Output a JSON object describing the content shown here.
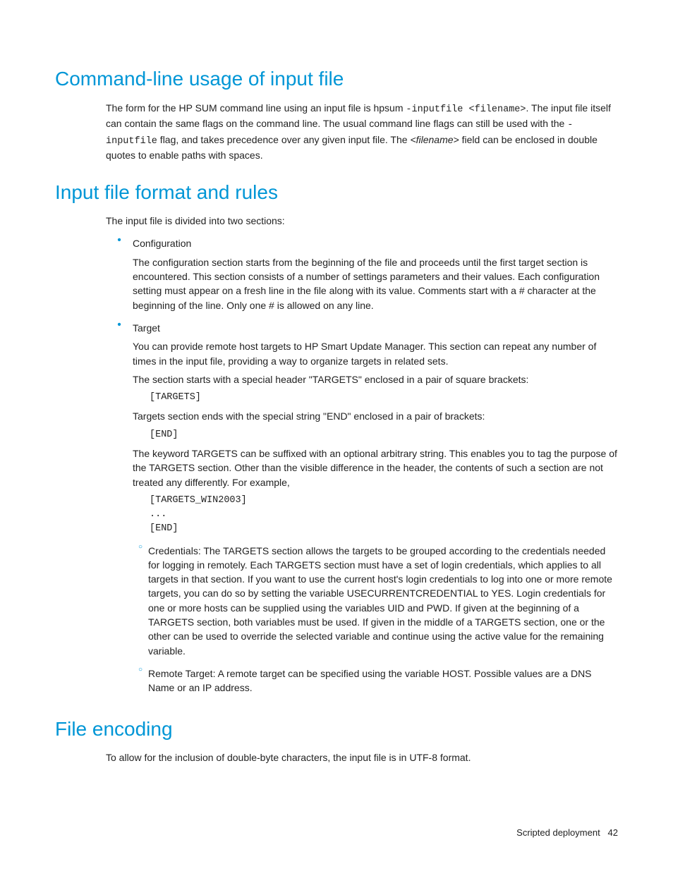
{
  "sections": {
    "s1": {
      "heading": "Command-line usage of input file",
      "p1a": "The form for the HP SUM command line using an input file is hpsum ",
      "p1code": "-inputfile <filename>",
      "p1b": ". The input file itself can contain the same flags on the command line. The usual command line flags can still be used with the ",
      "p1c_code": "-inputfile",
      "p1c": " flag, and takes precedence over any given input file. The ",
      "p1it": "<filename>",
      "p1d": " field can be enclosed in double quotes to enable paths with spaces."
    },
    "s2": {
      "heading": "Input file format and rules",
      "intro": "The input file is divided into two sections:",
      "b1": {
        "label": "Configuration",
        "p": "The configuration section starts from the beginning of the file and proceeds until the first target section is encountered. This section consists of a number of settings parameters and their values. Each configuration setting must appear on a fresh line in the file along with its value. Comments start with a # character at the beginning of the line. Only one # is allowed on any line."
      },
      "b2": {
        "label": "Target",
        "p1": "You can provide remote host targets to HP Smart Update Manager. This section can repeat any number of times in the input file, providing a way to organize targets in related sets.",
        "p2": "The section starts with a special header \"TARGETS\" enclosed in a pair of square brackets:",
        "code1": "[TARGETS]",
        "p3": "Targets section ends with the special string \"END\" enclosed in a pair of brackets:",
        "code2": "[END]",
        "p4": "The keyword TARGETS can be suffixed with an optional arbitrary string. This enables you to tag the purpose of the TARGETS section. Other than the visible difference in the header, the contents of such a section are not treated any differently. For example,",
        "code3a": "[TARGETS_WIN2003]",
        "code3b": "...",
        "code3c": "[END]",
        "sub1": "Credentials: The TARGETS section allows the targets to be grouped according to the credentials needed for logging in remotely. Each TARGETS section must have a set of login credentials, which applies to all targets in that section. If you want to use the current host's login credentials to log into one or more remote targets, you can do so by setting the variable USECURRENTCREDENTIAL to YES. Login credentials for one or more hosts can be supplied using the variables UID and PWD. If given at the beginning of a TARGETS section, both variables must be used. If given in the middle of a TARGETS section, one or the other can be used to override the selected variable and continue using the active value for the remaining variable.",
        "sub2": "Remote Target: A remote target can be specified using the variable HOST. Possible values are a DNS Name or an IP address."
      }
    },
    "s3": {
      "heading": "File encoding",
      "p": "To allow for the inclusion of double-byte characters, the input file is in UTF-8 format."
    }
  },
  "footer": {
    "label": "Scripted deployment",
    "page": "42"
  }
}
